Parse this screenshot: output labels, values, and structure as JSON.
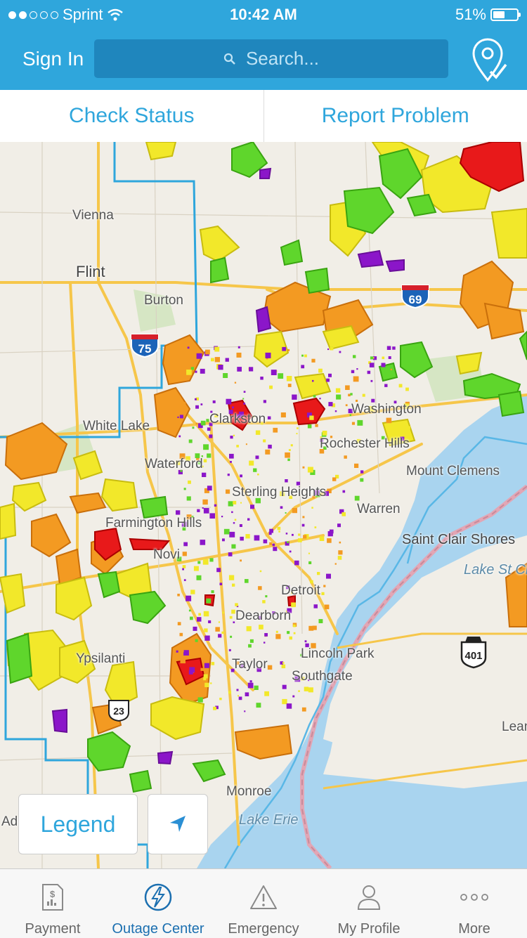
{
  "status_bar": {
    "carrier": "Sprint",
    "time": "10:42 AM",
    "battery": "51%",
    "battery_level": 0.51
  },
  "header": {
    "sign_in": "Sign In",
    "search_placeholder": "Search..."
  },
  "tabs": [
    {
      "label": "Check Status"
    },
    {
      "label": "Report Problem"
    }
  ],
  "map": {
    "labels": {
      "vienna": "Vienna",
      "flint": "Flint",
      "burton": "Burton",
      "white_lake": "White Lake",
      "clarkston": "Clarkston",
      "waterford": "Waterford",
      "rochester_hills": "Rochester Hills",
      "washington": "Washington",
      "mount_clemens": "Mount Clemens",
      "sterling_heights": "Sterling Heights",
      "warren": "Warren",
      "farmington_hills": "Farmington Hills",
      "novi": "Novi",
      "saint_clair_shores": "Saint Clair Shores",
      "lake_st_clair": "Lake St Clair",
      "lincoln_park": "Lincoln Park",
      "southgate": "Southgate",
      "taylor": "Taylor",
      "ypsilanti": "Ypsilanti",
      "monroe": "Monroe",
      "lake_erie": "Lake Erie",
      "leamington": "Leamington",
      "adrian": "Adrian",
      "dearborn": "Dearborn",
      "detroit": "Detroit"
    },
    "highway_shields": {
      "i75": "75",
      "i69": "69",
      "on401": "401",
      "us23": "23"
    },
    "outage_colors": {
      "red": "#e8191a",
      "orange": "#f39a22",
      "yellow": "#f2e82a",
      "green": "#5fd62c",
      "purple": "#8b16c9"
    }
  },
  "buttons": {
    "legend": "Legend"
  },
  "tabbar": [
    {
      "label": "Payment",
      "icon": "payment-icon"
    },
    {
      "label": "Outage Center",
      "icon": "outage-center-icon",
      "active": true
    },
    {
      "label": "Emergency",
      "icon": "emergency-icon"
    },
    {
      "label": "My Profile",
      "icon": "my-profile-icon"
    },
    {
      "label": "More",
      "icon": "more-icon"
    }
  ]
}
